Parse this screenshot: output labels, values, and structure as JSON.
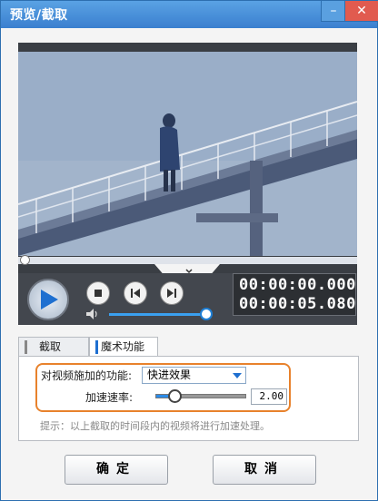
{
  "window": {
    "title": "预览/截取",
    "minimize_glyph": "–",
    "close_glyph": "✕"
  },
  "player": {
    "current_time": "00:00:00.000",
    "total_time": "00:00:05.080",
    "seek_progress": 0,
    "volume_level": 0.95,
    "icons": [
      "play-icon",
      "stop-icon",
      "prev-frame-icon",
      "next-frame-icon",
      "volume-icon",
      "chevron-down-icon"
    ]
  },
  "tabs": [
    {
      "label": "截取",
      "active": false
    },
    {
      "label": "魔术功能",
      "active": true
    }
  ],
  "magic": {
    "function_label": "对视频施加的功能:",
    "function_value": "快进效果",
    "speed_label": "加速速率:",
    "speed_value": "2.00",
    "speed_slider_level": 0.2,
    "hint": "提示：以上截取的时间段内的视频将进行加速处理。"
  },
  "buttons": {
    "ok": "确定",
    "cancel": "取消"
  },
  "colors": {
    "title_bar": "#3a7fcf",
    "accent_blue": "#1e6fd0",
    "highlight_orange": "#e8822c",
    "close_red": "#e15b4f"
  }
}
